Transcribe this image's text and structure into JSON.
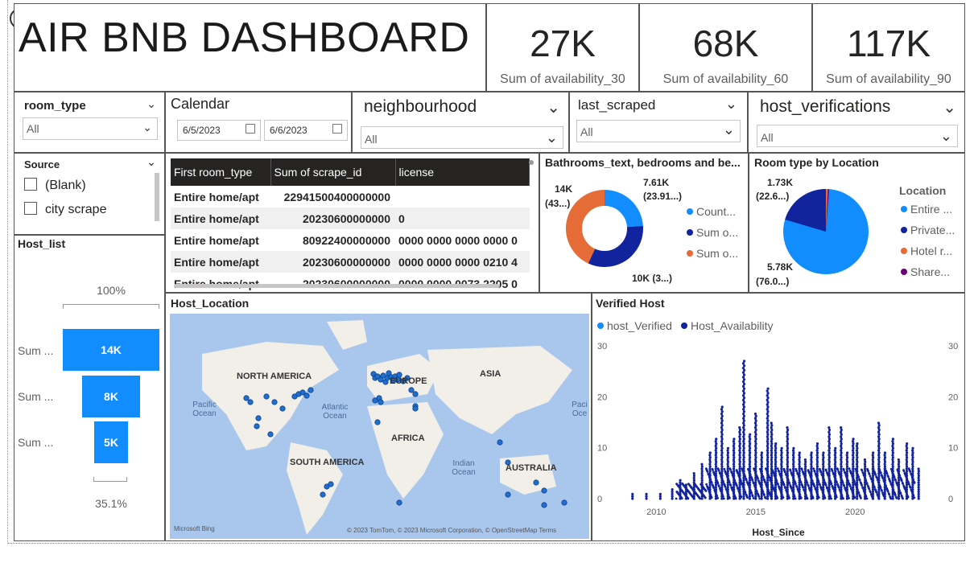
{
  "dashboard_title": "AIR BNB DASHBOARD",
  "cards": [
    {
      "value": "27K",
      "label": "Sum of availability_30"
    },
    {
      "value": "68K",
      "label": "Sum of availability_60"
    },
    {
      "value": "117K",
      "label": "Sum of availability_90"
    }
  ],
  "slicers": {
    "room_type": {
      "title": "room_type",
      "value": "All"
    },
    "calendar": {
      "title": "Calendar",
      "start": "6/5/2023",
      "end": "6/6/2023"
    },
    "neighbourhood": {
      "title": "neighbourhood",
      "value": "All"
    },
    "last_scraped": {
      "title": "last_scraped",
      "value": "All"
    },
    "host_verifications": {
      "title": "host_verifications",
      "value": "All"
    },
    "source": {
      "title": "Source",
      "items": [
        "(Blank)",
        "city scrape"
      ]
    }
  },
  "table": {
    "headers": [
      "First room_type",
      "Sum of scrape_id",
      "license"
    ],
    "rows": [
      [
        "Entire home/apt",
        "22941500400000000",
        ""
      ],
      [
        "Entire home/apt",
        "20230600000000",
        "0"
      ],
      [
        "Entire home/apt",
        "80922400000000",
        "0000 0000 0000 0000 0"
      ],
      [
        "Entire home/apt",
        "20230600000000",
        "0000 0000 0000 0210 4"
      ],
      [
        "Entire home/apt",
        "20230600000000",
        "0000 0000 0073 2205 0"
      ]
    ]
  },
  "donut": {
    "title": "Bathrooms_text, bedrooms and be...",
    "labels": [
      "7.61K",
      "(23.91...)",
      "14K",
      "(43...)",
      "10K (3...)"
    ],
    "legend": [
      "Count...",
      "Sum o...",
      "Sum o..."
    ],
    "colors": [
      "#118dff",
      "#12239e",
      "#e66c37"
    ]
  },
  "pie": {
    "title": "Room type by Location",
    "labels": [
      "1.73K",
      "(22.6...)",
      "5.78K",
      "(76.0...)"
    ],
    "legend_title": "Location",
    "legend": [
      "Entire ...",
      "Private...",
      "Hotel r...",
      "Share..."
    ],
    "colors": [
      "#118dff",
      "#12239e",
      "#e66c37",
      "#6b007b"
    ]
  },
  "host_list": {
    "title": "Host_list",
    "top_pct": "100%",
    "bottom_pct": "35.1%",
    "bars": [
      {
        "label": "Sum ...",
        "value": "14K",
        "fraction": 1.0
      },
      {
        "label": "Sum ...",
        "value": "8K",
        "fraction": 0.6
      },
      {
        "label": "Sum ...",
        "value": "5K",
        "fraction": 0.351
      }
    ]
  },
  "map": {
    "title": "Host_Location",
    "continents": [
      "NORTH AMERICA",
      "EUROPE",
      "ASIA",
      "AFRICA",
      "SOUTH AMERICA",
      "AUSTRALIA"
    ],
    "oceans": [
      "Pacific Ocean",
      "Atlantic Ocean",
      "Indian Ocean",
      "Paci Oce"
    ],
    "bing": "Microsoft Bing",
    "copyright": "© 2023 TomTom, © 2023 Microsoft Corporation, © OpenStreetMap  Terms"
  },
  "verified_host": {
    "title": "Verified Host",
    "legend": [
      "host_Verified",
      "Host_Availability"
    ],
    "colors": [
      "#118dff",
      "#12239e"
    ],
    "x_label": "Host_Since",
    "x_ticks": [
      "2010",
      "2015",
      "2020"
    ],
    "y_ticks": [
      "30",
      "20",
      "10",
      "0"
    ]
  },
  "chart_data": {
    "type": "scatter",
    "title": "Verified Host",
    "xlabel": "Host_Since",
    "ylabel": "",
    "xlim": [
      2008,
      2024
    ],
    "ylim": [
      0,
      30
    ],
    "series": [
      {
        "name": "Host_Availability",
        "points": [
          [
            2008.8,
            1
          ],
          [
            2009.5,
            1
          ],
          [
            2010.2,
            1
          ],
          [
            2010.8,
            2
          ],
          [
            2011.2,
            4
          ],
          [
            2011.5,
            3
          ],
          [
            2011.9,
            5
          ],
          [
            2012.3,
            7
          ],
          [
            2012.7,
            9
          ],
          [
            2013.0,
            12
          ],
          [
            2013.3,
            18
          ],
          [
            2013.6,
            10
          ],
          [
            2013.9,
            12
          ],
          [
            2014.2,
            14
          ],
          [
            2014.4,
            27
          ],
          [
            2014.7,
            13
          ],
          [
            2015.0,
            17
          ],
          [
            2015.3,
            9
          ],
          [
            2015.6,
            22
          ],
          [
            2015.8,
            15
          ],
          [
            2016.0,
            11
          ],
          [
            2016.3,
            10
          ],
          [
            2016.6,
            14
          ],
          [
            2016.9,
            10
          ],
          [
            2017.2,
            9
          ],
          [
            2017.5,
            8
          ],
          [
            2017.8,
            9
          ],
          [
            2018.1,
            11
          ],
          [
            2018.4,
            9
          ],
          [
            2018.7,
            14
          ],
          [
            2019.0,
            10
          ],
          [
            2019.3,
            14
          ],
          [
            2019.6,
            9
          ],
          [
            2019.9,
            12
          ],
          [
            2020.1,
            11
          ],
          [
            2020.5,
            8
          ],
          [
            2020.9,
            9
          ],
          [
            2021.2,
            15
          ],
          [
            2021.5,
            9
          ],
          [
            2021.9,
            12
          ],
          [
            2022.2,
            8
          ],
          [
            2022.6,
            11
          ],
          [
            2022.9,
            10
          ],
          [
            2023.2,
            6
          ]
        ]
      }
    ]
  }
}
